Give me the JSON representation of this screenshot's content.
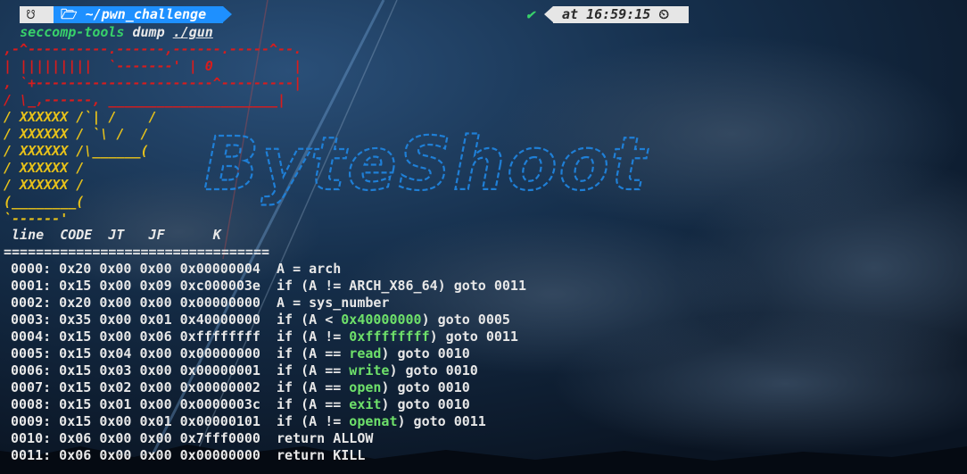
{
  "prompt": {
    "logo_icon": "terminal-icon",
    "folder_icon": "folder-icon",
    "path": "~/pwn_challenge",
    "status_icon": "check-icon",
    "time_text": "at 16:59:15",
    "clock_icon": "clock-icon"
  },
  "command": {
    "program": "seccomp-tools",
    "subcommand": "dump",
    "target": "./gun"
  },
  "ascii_art": {
    "red_lines": [
      ",-^----------.------,------.-----^--.",
      "| |||||||||  `-------' | 0          |",
      ", `+----------------------^---------|",
      "/ \\_,------, _____________________|"
    ],
    "yellow_lines": [
      "/ XXXXXX /`| /    /",
      "/ XXXXXX / `\\ /  /",
      "/ XXXXXX /\\______(",
      "/ XXXXXX /",
      "/ XXXXXX /",
      "(________(",
      "`------'"
    ],
    "logo_text": "ByteShoot"
  },
  "table": {
    "header": " line  CODE  JT   JF      K",
    "rule": "=================================",
    "rows": [
      {
        "pre": "0000: 0x20 0x00 0x00 0x00000004  A = arch",
        "hl": "",
        "post": ""
      },
      {
        "pre": "0001: 0x15 0x00 0x09 0xc000003e  if (A != ARCH_X86_64) goto 0011",
        "hl": "",
        "post": ""
      },
      {
        "pre": "0002: 0x20 0x00 0x00 0x00000000  A = sys_number",
        "hl": "",
        "post": ""
      },
      {
        "pre": "0003: 0x35 0x00 0x01 0x40000000  if (A < ",
        "hl": "0x40000000",
        "post": ") goto 0005"
      },
      {
        "pre": "0004: 0x15 0x00 0x06 0xffffffff  if (A != ",
        "hl": "0xffffffff",
        "post": ") goto 0011"
      },
      {
        "pre": "0005: 0x15 0x04 0x00 0x00000000  if (A == ",
        "hl": "read",
        "post": ") goto 0010"
      },
      {
        "pre": "0006: 0x15 0x03 0x00 0x00000001  if (A == ",
        "hl": "write",
        "post": ") goto 0010"
      },
      {
        "pre": "0007: 0x15 0x02 0x00 0x00000002  if (A == ",
        "hl": "open",
        "post": ") goto 0010"
      },
      {
        "pre": "0008: 0x15 0x01 0x00 0x0000003c  if (A == ",
        "hl": "exit",
        "post": ") goto 0010"
      },
      {
        "pre": "0009: 0x15 0x00 0x01 0x00000101  if (A != ",
        "hl": "openat",
        "post": ") goto 0011"
      },
      {
        "pre": "0010: 0x06 0x00 0x00 0x7fff0000  return ALLOW",
        "hl": "",
        "post": ""
      },
      {
        "pre": "0011: 0x06 0x00 0x00 0x00000000  return KILL",
        "hl": "",
        "post": ""
      }
    ]
  },
  "colors": {
    "accent_blue": "#1e90ff",
    "green": "#38d26a",
    "red": "#d91c1c",
    "yellow": "#e8c21a"
  }
}
